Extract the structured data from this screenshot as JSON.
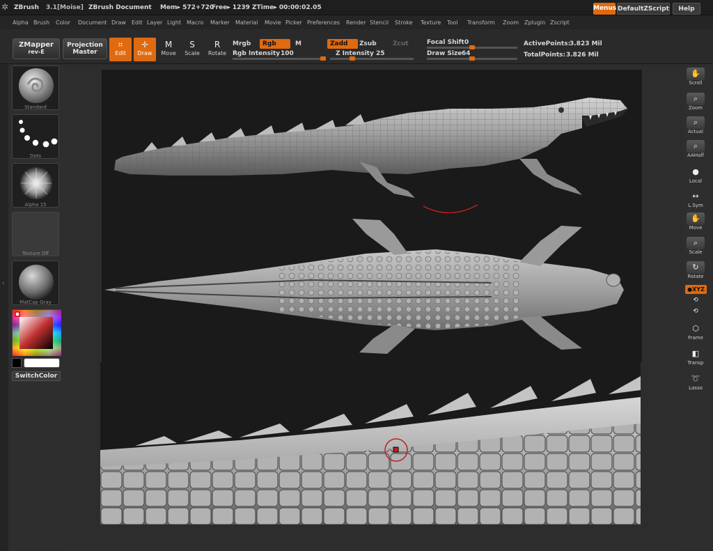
{
  "titlebar": {
    "app": "ZBrush",
    "version": "3.1[Moise]",
    "document": "ZBrush Document",
    "mem": "Mem▸ 572+720",
    "free": "Free▸ 1239",
    "ztime": "ZTime▸ 00:00:02.05",
    "menus_label": "Menus",
    "script_label": "DefaultZScript",
    "help_label": "Help"
  },
  "menubar": [
    "Alpha",
    "Brush",
    "Color",
    "Document",
    "Draw",
    "Edit",
    "Layer",
    "Light",
    "Macro",
    "Marker",
    "Material",
    "Movie",
    "Picker",
    "Preferences",
    "Render",
    "Stencil",
    "Stroke",
    "Texture",
    "Tool",
    "Transform",
    "Zoom",
    "Zplugin",
    "Zscript"
  ],
  "toolbar": {
    "zmapper_line1": "ZMapper",
    "zmapper_line2": "rev-E",
    "projection_line1": "Projection",
    "projection_line2": "Master",
    "edit_label": "Edit",
    "draw_label": "Draw",
    "move_label": "Move",
    "scale_label": "Scale",
    "rotate_label": "Rotate",
    "mrgb_label": "Mrgb",
    "rgb_label": "Rgb",
    "m_label": "M",
    "rgb_intensity_label": "Rgb Intensity",
    "rgb_intensity_value": "100",
    "zadd_label": "Zadd",
    "zsub_label": "Zsub",
    "zcut_label": "Zcut",
    "z_intensity_label": "Z Intensity",
    "z_intensity_value": "25",
    "focal_shift_label": "Focal Shift",
    "focal_shift_value": "0",
    "draw_size_label": "Draw Size",
    "draw_size_value": "64",
    "active_points_label": "ActivePoints:",
    "active_points_value": "3.823 Mil",
    "total_points_label": "TotalPoints:",
    "total_points_value": "3.826 Mil",
    "rgb_intensity_level": 1.0,
    "z_intensity_level": 0.25,
    "focal_shift_level": 0.5,
    "draw_size_level": 0.5
  },
  "leftpanel": {
    "brush_label": "Standard",
    "stroke_label": "Dots",
    "alpha_label": "Alpha 15",
    "texture_label": "Texture Off",
    "material_label": "MatCap Gray",
    "switchcolor_label": "SwitchColor"
  },
  "rightshelf": {
    "scroll": "Scroll",
    "zoom": "Zoom",
    "actual": "Actual",
    "aahalf": "AAHalf",
    "local": "Local",
    "lsym": "L.Sym",
    "move": "Move",
    "scale": "Scale",
    "rotate": "Rotate",
    "xyz": "●XYZ",
    "frame": "Frame",
    "transp": "Transp",
    "lasso": "Lasso"
  },
  "colors": {
    "accent": "#e06a10",
    "panel": "#2e2e2e",
    "canvas_bg": "#1a1a1a"
  }
}
